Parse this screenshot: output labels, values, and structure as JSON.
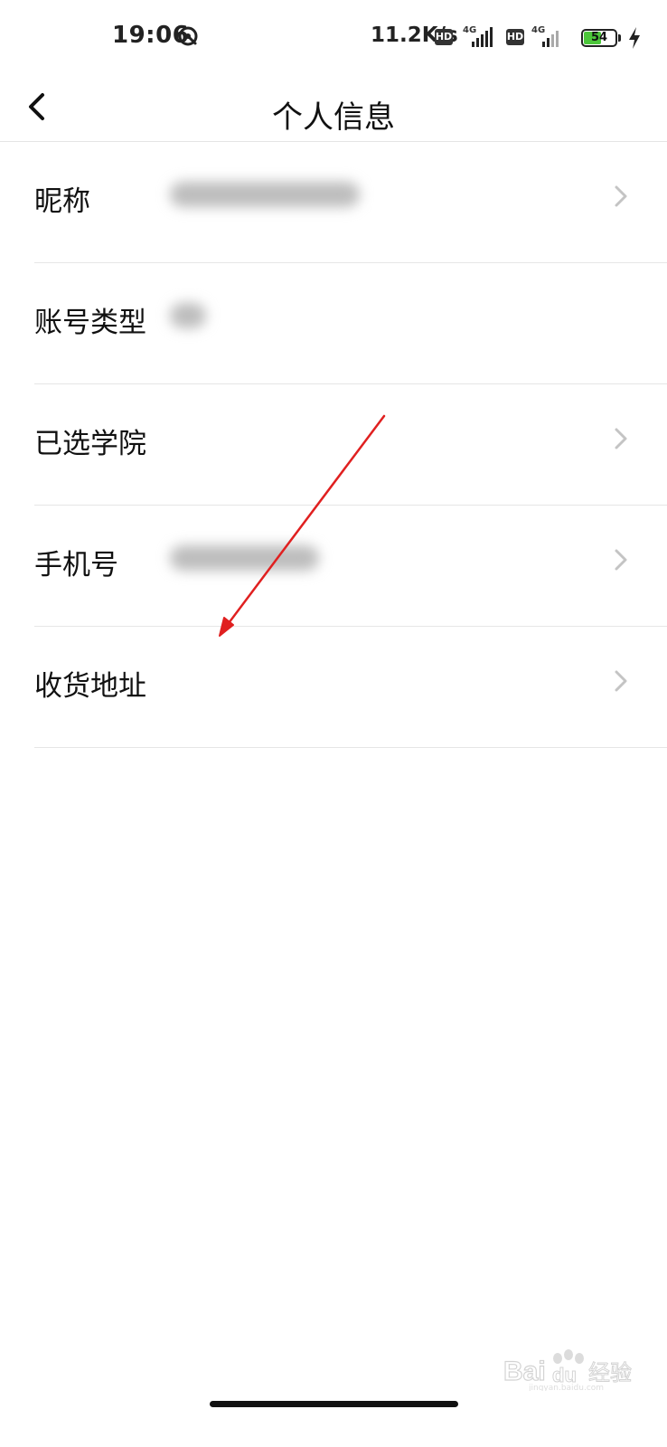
{
  "status_bar": {
    "time": "19:06",
    "net_speed": "11.2K/s",
    "hd_label": "HD",
    "network_type": "4G",
    "battery_level": "54",
    "battery_fraction": 0.54,
    "app_icon": "notification-app-icon",
    "charge_icon": "charging-bolt-icon"
  },
  "header": {
    "title": "个人信息",
    "back_icon": "back-chevron-icon"
  },
  "rows": [
    {
      "label": "昵称",
      "value_blurred": true,
      "has_chevron": true
    },
    {
      "label": "账号类型",
      "value_blurred": true,
      "has_chevron": false
    },
    {
      "label": "已选学院",
      "value_blurred": false,
      "has_chevron": true
    },
    {
      "label": "手机号",
      "value_blurred": true,
      "has_chevron": true
    },
    {
      "label": "收货地址",
      "value_blurred": false,
      "has_chevron": true
    }
  ],
  "annotation": {
    "type": "red-arrow",
    "color": "#e02020",
    "points_to": "收货地址"
  },
  "watermark": {
    "brand": "Baidu经验",
    "site": "jingyan.baidu.com"
  },
  "colors": {
    "divider": "#e6e6e6",
    "chevron": "#c4c4c4",
    "arrow": "#e02020",
    "battery_fill": "#4cc63a"
  }
}
